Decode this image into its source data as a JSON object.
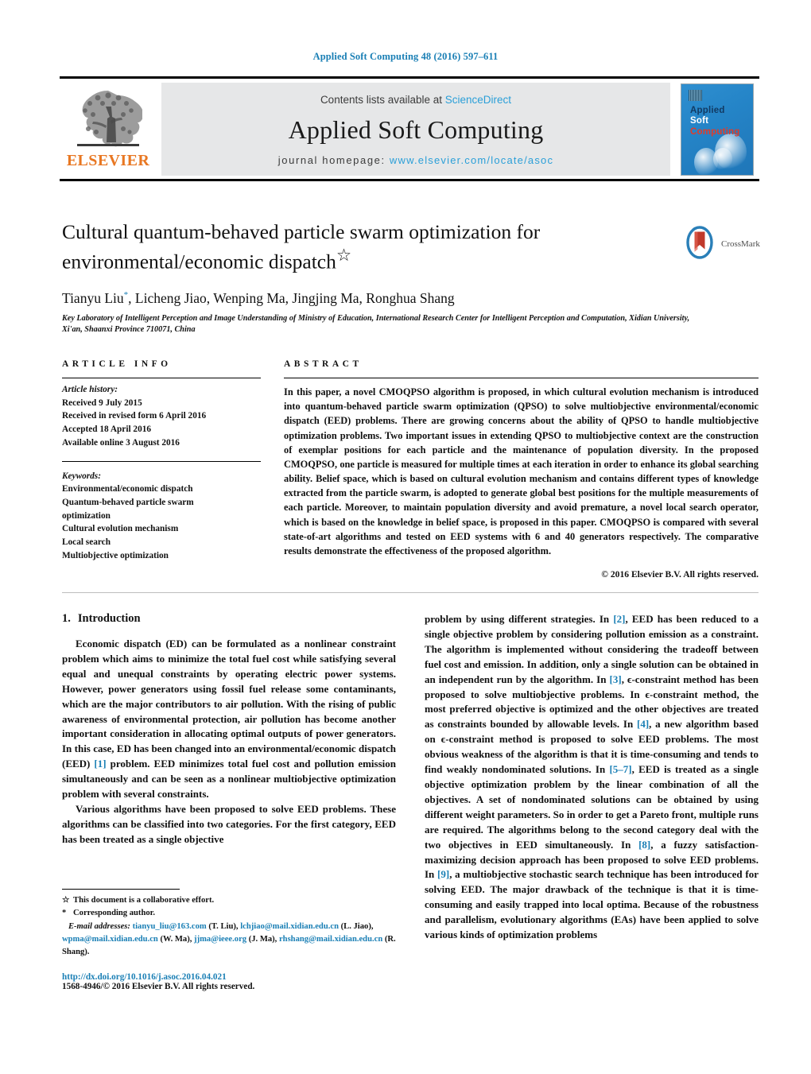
{
  "running_head": "Applied Soft Computing 48 (2016) 597–611",
  "masthead": {
    "publisher_name": "ELSEVIER",
    "contents_prefix": "Contents lists available at ",
    "contents_link": "ScienceDirect",
    "journal_name": "Applied Soft Computing",
    "homepage_prefix": "journal homepage: ",
    "homepage_url": "www.elsevier.com/locate/asoc",
    "cover": {
      "line1": "Applied",
      "line2": "Soft",
      "line3": "Computing"
    }
  },
  "article": {
    "title": "Cultural quantum-behaved particle swarm optimization for environmental/economic dispatch",
    "title_marker": "☆",
    "authors": "Tianyu Liu",
    "author_marker": "*",
    "authors_rest": ", Licheng Jiao, Wenping Ma, Jingjing Ma, Ronghua Shang",
    "affiliation": "Key Laboratory of Intelligent Perception and Image Understanding of Ministry of Education, International Research Center for Intelligent Perception and Computation, Xidian University, Xi'an, Shaanxi Province 710071, China",
    "crossmark_label": "CrossMark"
  },
  "info": {
    "heading": "ARTICLE INFO",
    "history_label": "Article history:",
    "history": [
      "Received 9 July 2015",
      "Received in revised form 6 April 2016",
      "Accepted 18 April 2016",
      "Available online 3 August 2016"
    ],
    "keywords_label": "Keywords:",
    "keywords": [
      "Environmental/economic dispatch",
      "Quantum-behaved particle swarm",
      "optimization",
      "Cultural evolution mechanism",
      "Local search",
      "Multiobjective optimization"
    ]
  },
  "abstract": {
    "heading": "ABSTRACT",
    "text": "In this paper, a novel CMOQPSO algorithm is proposed, in which cultural evolution mechanism is introduced into quantum-behaved particle swarm optimization (QPSO) to solve multiobjective environmental/economic dispatch (EED) problems. There are growing concerns about the ability of QPSO to handle multiobjective optimization problems. Two important issues in extending QPSO to multiobjective context are the construction of exemplar positions for each particle and the maintenance of population diversity. In the proposed CMOQPSO, one particle is measured for multiple times at each iteration in order to enhance its global searching ability. Belief space, which is based on cultural evolution mechanism and contains different types of knowledge extracted from the particle swarm, is adopted to generate global best positions for the multiple measurements of each particle. Moreover, to maintain population diversity and avoid premature, a novel local search operator, which is based on the knowledge in belief space, is proposed in this paper. CMOQPSO is compared with several state-of-art algorithms and tested on EED systems with 6 and 40 generators respectively. The comparative results demonstrate the effectiveness of the proposed algorithm.",
    "copyright": "© 2016 Elsevier B.V. All rights reserved."
  },
  "body": {
    "section_number": "1.",
    "section_title": "Introduction",
    "left_paragraph_1": "Economic dispatch (ED) can be formulated as a nonlinear constraint problem which aims to minimize the total fuel cost while satisfying several equal and unequal constraints by operating electric power systems. However, power generators using fossil fuel release some contaminants, which are the major contributors to air pollution. With the rising of public awareness of environmental protection, air pollution has become another important consideration in allocating optimal outputs of power generators. In this case, ED has been changed into an environmental/economic dispatch (EED) ",
    "left_paragraph_1_ref": "[1]",
    "left_paragraph_1_tail": " problem. EED minimizes total fuel cost and pollution emission simultaneously and can be seen as a nonlinear multiobjective optimization problem with several constraints.",
    "left_paragraph_2": "Various algorithms have been proposed to solve EED problems. These algorithms can be classified into two categories. For the first category, EED has been treated as a single objective",
    "right_segments": [
      {
        "text": "problem by using different strategies. In ",
        "type": "text"
      },
      {
        "text": "[2]",
        "type": "ref"
      },
      {
        "text": ", EED has been reduced to a single objective problem by considering pollution emission as a constraint. The algorithm is implemented without considering the tradeoff between fuel cost and emission. In addition, only a single solution can be obtained in an independent run by the algorithm. In ",
        "type": "text"
      },
      {
        "text": "[3]",
        "type": "ref"
      },
      {
        "text": ", ϵ-constraint method has been proposed to solve multiobjective problems. In ϵ-constraint method, the most preferred objective is optimized and the other objectives are treated as constraints bounded by allowable levels. In ",
        "type": "text"
      },
      {
        "text": "[4]",
        "type": "ref"
      },
      {
        "text": ", a new algorithm based on ϵ-constraint method is proposed to solve EED problems. The most obvious weakness of the algorithm is that it is time-consuming and tends to find weakly nondominated solutions. In ",
        "type": "text"
      },
      {
        "text": "[5–7]",
        "type": "ref"
      },
      {
        "text": ", EED is treated as a single objective optimization problem by the linear combination of all the objectives. A set of nondominated solutions can be obtained by using different weight parameters. So in order to get a Pareto front, multiple runs are required. The algorithms belong to the second category deal with the two objectives in EED simultaneously. In ",
        "type": "text"
      },
      {
        "text": "[8]",
        "type": "ref"
      },
      {
        "text": ", a fuzzy satisfaction-maximizing decision approach has been proposed to solve EED problems. In ",
        "type": "text"
      },
      {
        "text": "[9]",
        "type": "ref"
      },
      {
        "text": ", a multiobjective stochastic search technique has been introduced for solving EED. The major drawback of the technique is that it is time-consuming and easily trapped into local optima. Because of the robustness and parallelism, evolutionary algorithms (EAs) have been applied to solve various kinds of optimization problems",
        "type": "text"
      }
    ]
  },
  "footnotes": {
    "collab_marker": "☆",
    "collab_text": "This document is a collaborative effort.",
    "corr_marker": "*",
    "corr_text": "Corresponding author.",
    "email_label": "E-mail addresses:",
    "emails": [
      {
        "address": "tianyu_liu@163.com",
        "person": "(T. Liu)"
      },
      {
        "address": "lchjiao@mail.xidian.edu.cn",
        "person": "(L. Jiao)"
      },
      {
        "address": "wpma@mail.xidian.edu.cn",
        "person": "(W. Ma)"
      },
      {
        "address": "jjma@ieee.org",
        "person": "(J. Ma)"
      },
      {
        "address": "rhshang@mail.xidian.edu.cn",
        "person": "(R. Shang)"
      }
    ],
    "doi": "http://dx.doi.org/10.1016/j.asoc.2016.04.021",
    "issn_line": "1568-4946/© 2016 Elsevier B.V. All rights reserved."
  },
  "colors": {
    "link_blue": "#1a7fb5",
    "sciencedirect_blue": "#2a9fd8",
    "elsevier_orange": "#e87722",
    "cover_blue": "#2585c8",
    "crossmark_red": "#c0392b"
  }
}
